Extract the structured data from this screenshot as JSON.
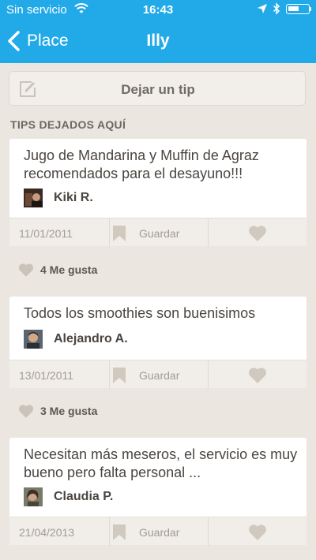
{
  "status_bar": {
    "carrier": "Sin servicio",
    "time": "16:43"
  },
  "nav": {
    "back_label": "Place",
    "title": "Illy"
  },
  "tip_button": {
    "label": "Dejar un tip"
  },
  "section_title": "TIPS DEJADOS AQUÍ",
  "tips": [
    {
      "text": "Jugo de Mandarina y Muffin de Agraz recomendados para el desayuno!!!",
      "author": "Kiki R.",
      "date": "11/01/2011",
      "save_label": "Guardar",
      "likes": "4 Me gusta"
    },
    {
      "text": "Todos los smoothies son buenisimos",
      "author": "Alejandro A.",
      "date": "13/01/2011",
      "save_label": "Guardar",
      "likes": "3 Me gusta"
    },
    {
      "text": "Necesitan más meseros, el servicio es muy bueno pero falta personal ...",
      "author": "Claudia P.",
      "date": "21/04/2013",
      "save_label": "Guardar"
    }
  ],
  "colors": {
    "header": "#22a9e8",
    "background": "#ebe7e0",
    "icon_gray": "#cfc9c0"
  }
}
